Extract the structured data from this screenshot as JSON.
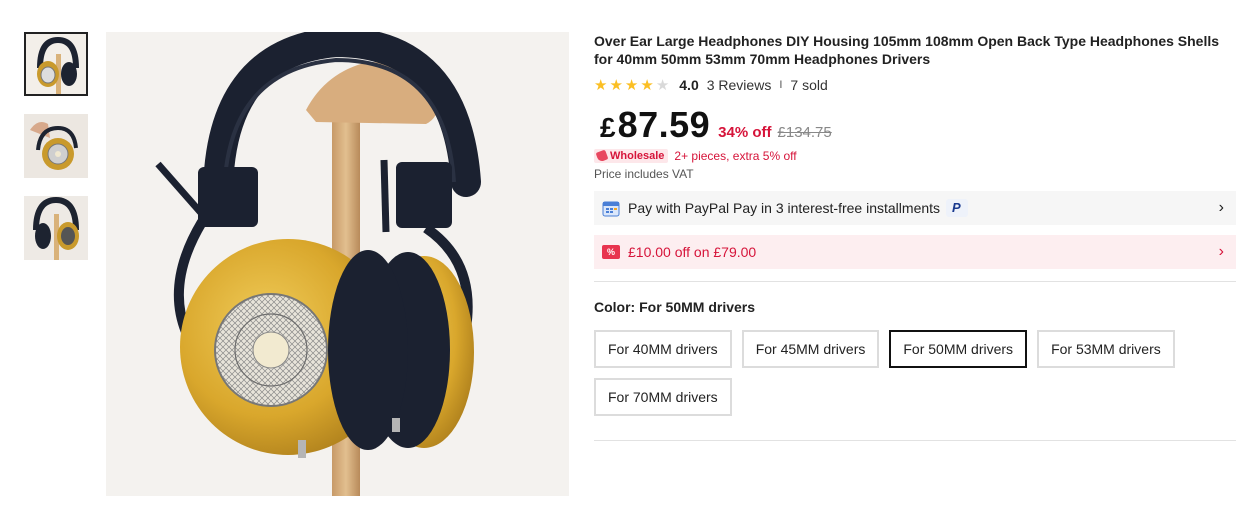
{
  "product": {
    "title": "Over Ear Large Headphones DIY Housing 105mm 108mm Open Back Type Headphones Shells for 40mm 50mm 53mm 70mm Headphones Drivers",
    "rating": {
      "value": "4.0",
      "stars_filled": 4,
      "stars_total": 5,
      "reviews": "3 Reviews",
      "separator": "I",
      "sold": "7 sold"
    },
    "price": {
      "currency": "£",
      "amount": "87.59",
      "discount": "34% off",
      "original": "£134.75"
    },
    "wholesale": {
      "badge": "Wholesale",
      "text": "2+ pieces, extra 5% off"
    },
    "vat_note": "Price includes VAT",
    "paypal": {
      "text": "Pay with PayPal Pay in 3 interest-free installments",
      "logo_letter": "P",
      "icon": "calendar-icon"
    },
    "coupon": {
      "text": "£10.00 off on £79.00",
      "icon_text": "%"
    },
    "color": {
      "label": "Color: For 50MM drivers",
      "options": [
        {
          "label": "For 40MM drivers",
          "selected": false
        },
        {
          "label": "For 45MM drivers",
          "selected": false
        },
        {
          "label": "For 50MM drivers",
          "selected": true
        },
        {
          "label": "For 53MM drivers",
          "selected": false
        },
        {
          "label": "For 70MM drivers",
          "selected": false
        }
      ]
    },
    "chevron": "›"
  },
  "colors": {
    "accent_red": "#d6143a",
    "star": "#fbbf24",
    "wholesale_bg": "#fde7ea",
    "coupon_bg": "#fdeef0",
    "paypal_bg": "#f6f6f6"
  }
}
